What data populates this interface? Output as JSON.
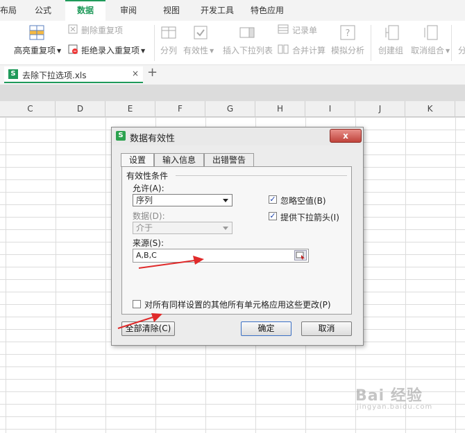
{
  "ribbon_tabs": [
    "布局",
    "公式",
    "数据",
    "审阅",
    "视图",
    "开发工具",
    "特色应用"
  ],
  "active_tab": "数据",
  "ribbon": {
    "highlight_duplicates": "高亮重复项",
    "delete_duplicates": "删除重复项",
    "reject_duplicate_entry": "拒绝录入重复项",
    "split_column": "分列",
    "validity": "有效性",
    "insert_dropdown": "插入下拉列表",
    "record_sheet": "记录单",
    "merge_calc": "合并计算",
    "simulation_analysis": "模拟分析",
    "create_group": "创建组",
    "ungroup": "取消组合",
    "subtotal_partial": "分"
  },
  "document_tab": {
    "name": "去除下拉选项.xls",
    "close": "×",
    "new_tab": "+"
  },
  "columns": [
    "C",
    "D",
    "E",
    "F",
    "G",
    "H",
    "I",
    "J",
    "K"
  ],
  "dialog": {
    "icon_letter": "S",
    "title": "数据有效性",
    "close_label": "x",
    "tabs": [
      "设置",
      "输入信息",
      "出错警告"
    ],
    "section_title": "有效性条件",
    "allow_label": "允许(A):",
    "allow_value": "序列",
    "data_label": "数据(D):",
    "data_value": "介于",
    "ignore_blank_label": "忽略空值(B)",
    "ignore_blank_checked": true,
    "dropdown_label": "提供下拉箭头(I)",
    "dropdown_checked": true,
    "source_label": "来源(S):",
    "source_value": "A,B,C",
    "apply_all_label": "对所有同样设置的其他所有单元格应用这些更改(P)",
    "apply_all_checked": false,
    "clear_all_button": "全部清除(C)",
    "ok_button": "确定",
    "cancel_button": "取消"
  },
  "watermark": {
    "main": "Bai 经验",
    "sub": "jingyan.baidu.com"
  },
  "colors": {
    "accent": "#1f9a5a",
    "arrow": "#e02a2a"
  }
}
